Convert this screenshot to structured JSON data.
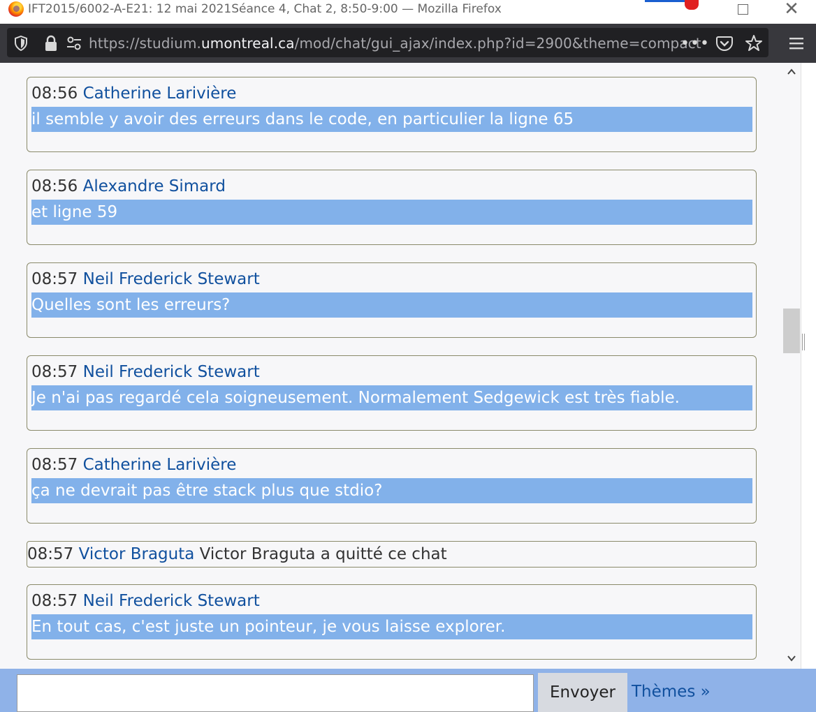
{
  "window": {
    "title": "IFT2015/6002-A-E21: 12 mai 2021Séance 4, Chat 2, 8:50-9:00 — Mozilla Firefox"
  },
  "urlbar": {
    "prefix": "https://studium.",
    "domain": "umontreal.ca",
    "suffix": "/mod/chat/gui_ajax/index.php?id=2900&theme=compact",
    "more_actions_label": "•••"
  },
  "messages": [
    {
      "time": "08:56",
      "author": "Catherine Larivière",
      "text": "il semble y avoir des erreurs dans le code, en particulier la ligne 65"
    },
    {
      "time": "08:56",
      "author": "Alexandre Simard",
      "text": "et ligne 59"
    },
    {
      "time": "08:57",
      "author": "Neil Frederick Stewart",
      "text": "Quelles sont les erreurs?"
    },
    {
      "time": "08:57",
      "author": "Neil Frederick Stewart",
      "text": "Je n'ai pas regardé cela soigneusement. Normalement Sedgewick est très fiable."
    },
    {
      "time": "08:57",
      "author": "Catherine Larivière",
      "text": "ça ne devrait pas être stack plus que stdio?"
    }
  ],
  "system_message": {
    "time": "08:57",
    "author": "Victor Braguta",
    "text": "Victor Braguta a quitté ce chat"
  },
  "last_message": {
    "time": "08:57",
    "author": "Neil Frederick Stewart",
    "text": "En tout cas, c'est juste un pointeur, je vous laisse explorer."
  },
  "composer": {
    "value": "",
    "send_label": "Envoyer",
    "themes_label": "Thèmes »"
  },
  "icons": {
    "browser": "firefox-logo-icon",
    "tracking": "shield-icon",
    "security": "lock-icon",
    "permissions": "permissions-icon",
    "pocket": "pocket-icon",
    "bookmark": "star-icon",
    "menu": "hamburger-menu-icon"
  },
  "colors": {
    "message_highlight": "#82b1ea",
    "author_link": "#10509e",
    "footer_bg": "#8fb2e8",
    "toolbar_bg": "#38383d"
  }
}
